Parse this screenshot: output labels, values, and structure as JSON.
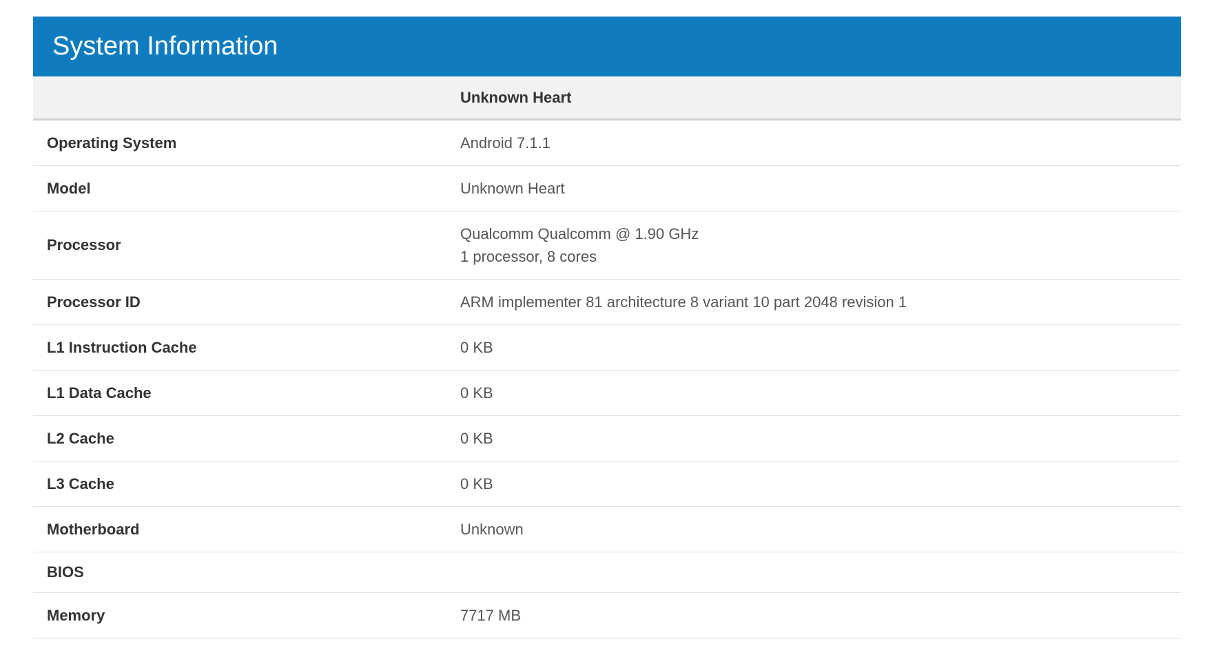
{
  "header": {
    "title": "System Information"
  },
  "device_name": "Unknown Heart",
  "rows": [
    {
      "label": "Operating System",
      "value": "Android 7.1.1"
    },
    {
      "label": "Model",
      "value": "Unknown Heart"
    },
    {
      "label": "Processor",
      "value": "Qualcomm Qualcomm @ 1.90 GHz\n1 processor, 8 cores"
    },
    {
      "label": "Processor ID",
      "value": "ARM implementer 81 architecture 8 variant 10 part 2048 revision 1"
    },
    {
      "label": "L1 Instruction Cache",
      "value": "0 KB"
    },
    {
      "label": "L1 Data Cache",
      "value": "0 KB"
    },
    {
      "label": "L2 Cache",
      "value": "0 KB"
    },
    {
      "label": "L3 Cache",
      "value": "0 KB"
    },
    {
      "label": "Motherboard",
      "value": "Unknown"
    },
    {
      "label": "BIOS",
      "value": ""
    },
    {
      "label": "Memory",
      "value": "7717 MB"
    }
  ]
}
